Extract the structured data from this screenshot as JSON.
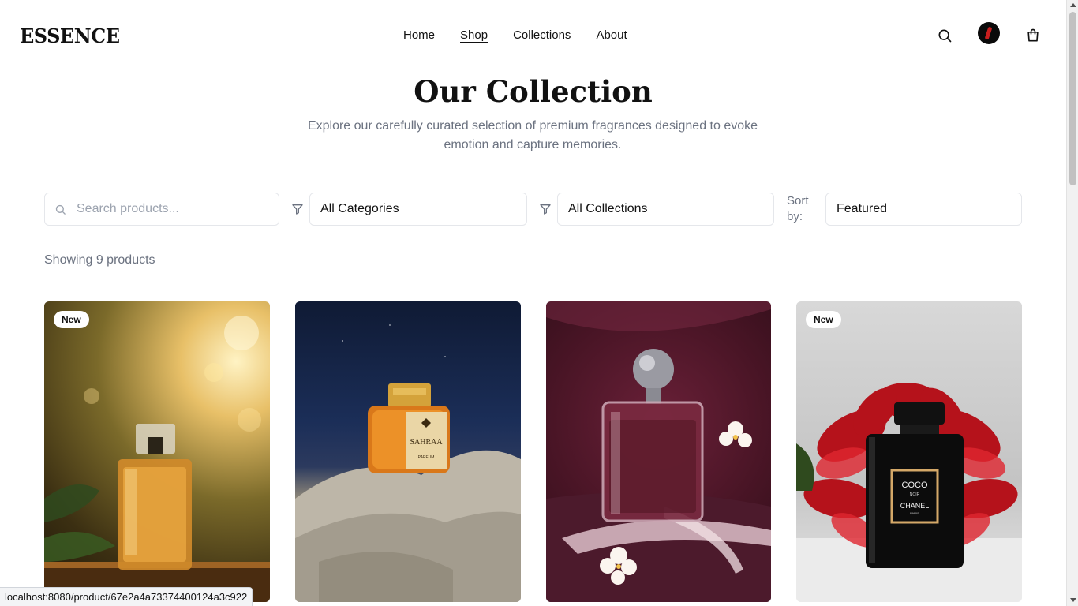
{
  "brand": {
    "logo": "ESSENCE"
  },
  "nav": {
    "items": [
      {
        "label": "Home"
      },
      {
        "label": "Shop"
      },
      {
        "label": "Collections"
      },
      {
        "label": "About"
      }
    ]
  },
  "header_icons": [
    "search-icon",
    "avatar",
    "shopping-bag-icon"
  ],
  "hero": {
    "title": "Our Collection",
    "subtitle": "Explore our carefully curated selection of premium fragrances designed to evoke emotion and capture memories."
  },
  "filters": {
    "search_placeholder": "Search products...",
    "category": "All Categories",
    "collection": "All Collections",
    "sort_label": "Sort by:",
    "sort_value": "Featured"
  },
  "results": {
    "count_text": "Showing 9 products"
  },
  "products": [
    {
      "badge": "New"
    },
    {
      "badge": "",
      "bottle_label": "SAHRAA",
      "bottle_sub": "PARFUM"
    },
    {
      "badge": ""
    },
    {
      "badge": "New",
      "bottle_label_1": "COCO",
      "bottle_label_2": "NOIR",
      "bottle_label_3": "CHANEL",
      "bottle_label_4": "PARIS"
    }
  ],
  "status_bar": {
    "url": "localhost:8080/product/67e2a4a73374400124a3c922"
  },
  "colors": {
    "text": "#111111",
    "muted": "#6b7280",
    "border": "#e5e7eb",
    "accent": "#c81e1e"
  }
}
